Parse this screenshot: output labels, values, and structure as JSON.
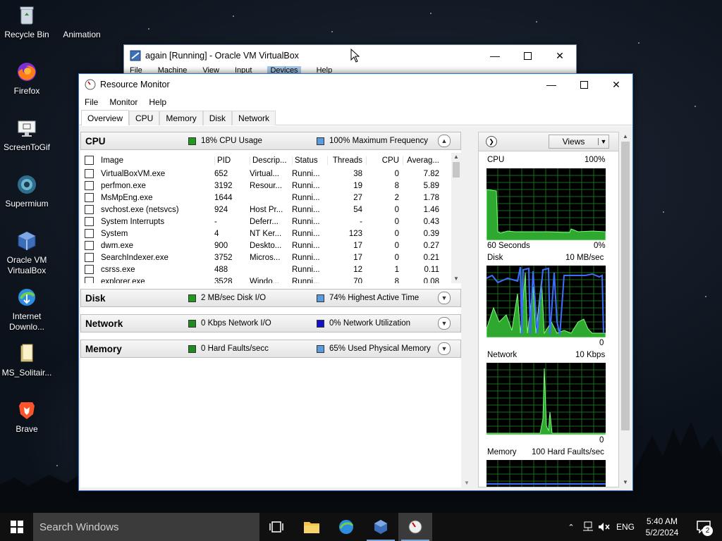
{
  "desktop": {
    "icons": [
      {
        "label": "Recycle Bin"
      },
      {
        "label": "Animation"
      },
      {
        "label": "Firefox"
      },
      {
        "label": "ScreenToGif"
      },
      {
        "label": "Supermium"
      },
      {
        "label": "Oracle VM VirtualBox"
      },
      {
        "label": "Internet Downlo..."
      },
      {
        "label": "MS_Solitair..."
      },
      {
        "label": "Brave"
      }
    ]
  },
  "vbox_window": {
    "title": "again [Running] - Oracle VM VirtualBox",
    "menu": [
      "File",
      "Machine",
      "View",
      "Input",
      "Devices",
      "Help"
    ]
  },
  "resmon": {
    "title": "Resource Monitor",
    "menu": [
      "File",
      "Monitor",
      "Help"
    ],
    "tabs": [
      "Overview",
      "CPU",
      "Memory",
      "Disk",
      "Network"
    ],
    "active_tab": "Overview",
    "sections": {
      "cpu": {
        "name": "CPU",
        "stat1": "18% CPU Usage",
        "stat1_color": "#1f9a1f",
        "stat2": "100% Maximum Frequency",
        "stat2_color": "#5a9be0"
      },
      "disk": {
        "name": "Disk",
        "stat1": "2 MB/sec Disk I/O",
        "stat1_color": "#1f9a1f",
        "stat2": "74% Highest Active Time",
        "stat2_color": "#5a9be0"
      },
      "network": {
        "name": "Network",
        "stat1": "0 Kbps Network I/O",
        "stat1_color": "#1f8a1f",
        "stat2": "0% Network Utilization",
        "stat2_color": "#1010c8"
      },
      "memory": {
        "name": "Memory",
        "stat1": "0 Hard Faults/secc",
        "stat1_color": "#1f8a1f",
        "stat2": "65% Used Physical Memory",
        "stat2_color": "#5a9be0"
      }
    },
    "columns": {
      "image": "Image",
      "pid": "PID",
      "desc": "Descrip...",
      "status": "Status",
      "threads": "Threads",
      "cpu": "CPU",
      "avg": "Averag..."
    },
    "processes": [
      {
        "image": "VirtualBoxVM.exe",
        "pid": "652",
        "desc": "Virtual...",
        "status": "Runni...",
        "threads": "38",
        "cpu": "0",
        "avg": "7.82"
      },
      {
        "image": "perfmon.exe",
        "pid": "3192",
        "desc": "Resour...",
        "status": "Runni...",
        "threads": "19",
        "cpu": "8",
        "avg": "5.89"
      },
      {
        "image": "MsMpEng.exe",
        "pid": "1644",
        "desc": "",
        "status": "Runni...",
        "threads": "27",
        "cpu": "2",
        "avg": "1.78"
      },
      {
        "image": "svchost.exe (netsvcs)",
        "pid": "924",
        "desc": "Host Pr...",
        "status": "Runni...",
        "threads": "54",
        "cpu": "0",
        "avg": "1.46"
      },
      {
        "image": "System Interrupts",
        "pid": "-",
        "desc": "Deferr...",
        "status": "Runni...",
        "threads": "-",
        "cpu": "0",
        "avg": "0.43"
      },
      {
        "image": "System",
        "pid": "4",
        "desc": "NT Ker...",
        "status": "Runni...",
        "threads": "123",
        "cpu": "0",
        "avg": "0.39"
      },
      {
        "image": "dwm.exe",
        "pid": "900",
        "desc": "Deskto...",
        "status": "Runni...",
        "threads": "17",
        "cpu": "0",
        "avg": "0.27"
      },
      {
        "image": "SearchIndexer.exe",
        "pid": "3752",
        "desc": "Micros...",
        "status": "Runni...",
        "threads": "17",
        "cpu": "0",
        "avg": "0.21"
      },
      {
        "image": "csrss.exe",
        "pid": "488",
        "desc": "",
        "status": "Runni...",
        "threads": "12",
        "cpu": "1",
        "avg": "0.11"
      },
      {
        "image": "explorer.exe",
        "pid": "3528",
        "desc": "Windo...",
        "status": "Runni...",
        "threads": "70",
        "cpu": "8",
        "avg": "0.08"
      }
    ],
    "right": {
      "views_label": "Views",
      "cpu_graph": {
        "title": "CPU",
        "max": "100%",
        "time": "60 Seconds",
        "min": "0%"
      },
      "disk_graph": {
        "title": "Disk",
        "max": "10 MB/sec",
        "min": "0"
      },
      "network_graph": {
        "title": "Network",
        "max": "10 Kbps",
        "min": "0"
      },
      "memory_graph": {
        "title": "Memory",
        "max": "100 Hard Faults/sec"
      }
    }
  },
  "taskbar": {
    "search_placeholder": "Search Windows",
    "tray": {
      "language": "ENG",
      "time": "5:40 AM",
      "date": "5/2/2024",
      "notifications": "2"
    }
  }
}
